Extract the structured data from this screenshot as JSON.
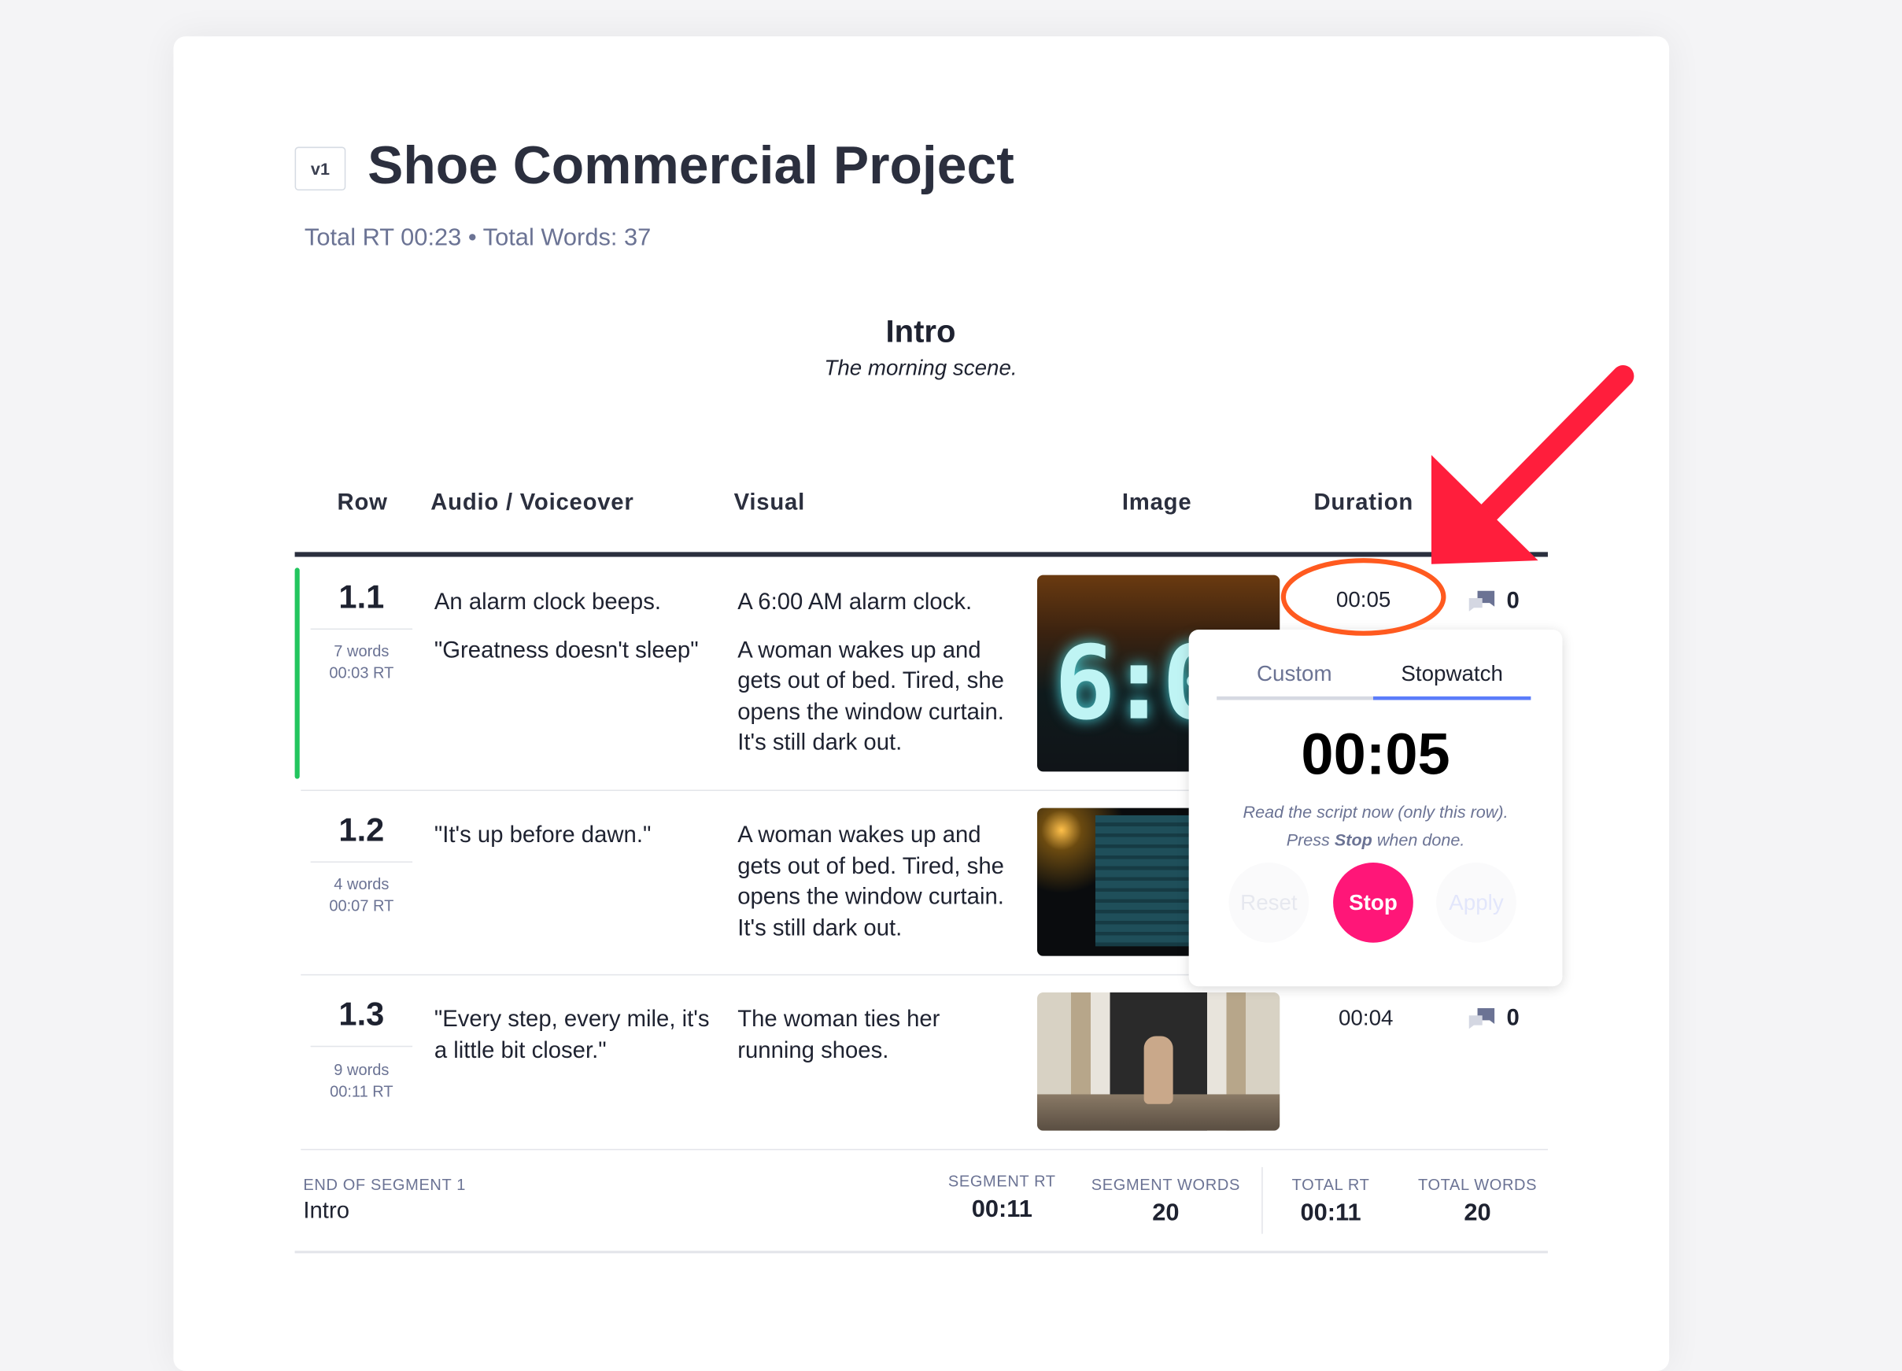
{
  "project": {
    "version": "v1",
    "title": "Shoe Commercial Project",
    "summary": "Total RT 00:23 • Total Words: 37"
  },
  "segment": {
    "title": "Intro",
    "description": "The morning scene."
  },
  "table": {
    "headers": {
      "row": "Row",
      "audio": "Audio / Voiceover",
      "visual": "Visual",
      "image": "Image",
      "duration": "Duration"
    },
    "rows": [
      {
        "num": "1.1",
        "words": "7 words",
        "rt": "00:03 RT",
        "audio": [
          "An alarm clock beeps.",
          "\"Greatness doesn't sleep\""
        ],
        "visual": [
          "A 6:00 AM alarm clock.",
          "A woman wakes up and gets out of bed. Tired, she opens the window curtain. It's still dark out."
        ],
        "duration": "00:05",
        "comments": "0",
        "active": true
      },
      {
        "num": "1.2",
        "words": "4 words",
        "rt": "00:07 RT",
        "audio": [
          "\"It's up before dawn.\""
        ],
        "visual": [
          "A woman wakes up and gets out of bed. Tired, she opens the window curtain. It's still dark out."
        ],
        "duration": "",
        "comments": ""
      },
      {
        "num": "1.3",
        "words": "9 words",
        "rt": "00:11 RT",
        "audio": [
          "\"Every step, every mile, it's a little bit closer.\""
        ],
        "visual": [
          "The woman ties her running shoes."
        ],
        "duration": "00:04",
        "comments": "0"
      }
    ]
  },
  "footer": {
    "end_label": "END OF SEGMENT 1",
    "segment_name": "Intro",
    "segment_rt_label": "SEGMENT RT",
    "segment_rt": "00:11",
    "segment_words_label": "SEGMENT WORDS",
    "segment_words": "20",
    "total_rt_label": "TOTAL RT",
    "total_rt": "00:11",
    "total_words_label": "TOTAL WORDS",
    "total_words": "20"
  },
  "popover": {
    "tabs": [
      "Custom",
      "Stopwatch"
    ],
    "active_tab": "Stopwatch",
    "time": "00:05",
    "instruction_line1": "Read the script now (only this row).",
    "instruction_pre": "Press ",
    "instruction_bold": "Stop",
    "instruction_post": " when done.",
    "buttons": {
      "reset": "Reset",
      "stop": "Stop",
      "apply": "Apply"
    }
  },
  "colors": {
    "accent_blue": "#5b7cfa",
    "stop_pink": "#ff1678",
    "active_row": "#22c55e",
    "annotation_orange": "#ff5a1f",
    "annotation_red": "#ff1e3c"
  },
  "icons": {
    "comment": "comment-bubbles-icon"
  }
}
